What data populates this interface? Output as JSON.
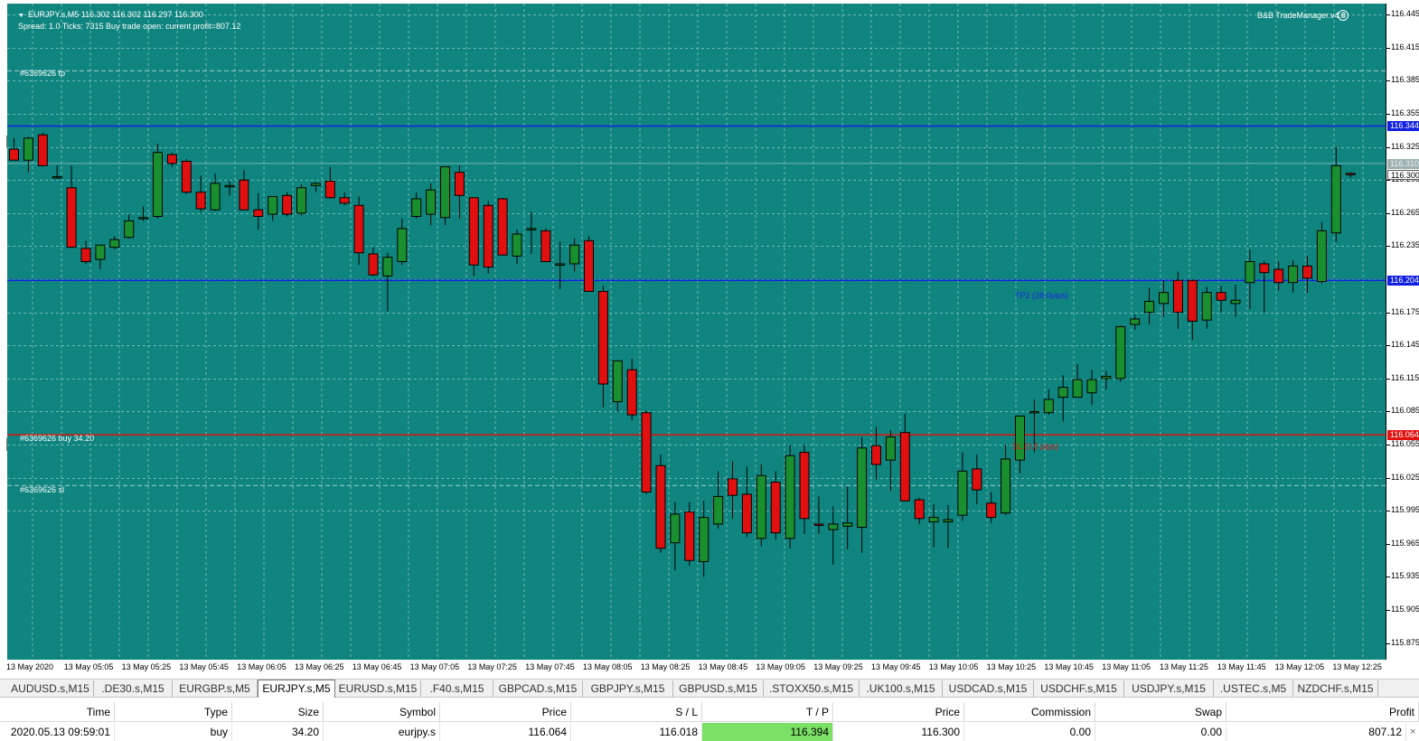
{
  "chart": {
    "symbol_line": "EURJPY.s,M5  116.302 116.302 116.297 116.300",
    "spread_line": "Spread: 1.0  Ticks: 7315  Buy trade open: current profit=807.12",
    "ea_name": "B&B TradeManager.v4.8",
    "colors": {
      "background": "#10857f",
      "grid": "#6fb8b2",
      "bull": "#1a8f2f",
      "bear": "#e01010",
      "tp_line": "#1020e0",
      "entry_line": "#e01010"
    },
    "order_labels": {
      "tp": "#6369626 tp",
      "buy": "#6369626 buy 34.20",
      "sl": "#6369626 sl"
    },
    "line_labels": {
      "tp2": "TP2 (28.0pips)",
      "sl": "SL (0.0 pips)"
    },
    "price_axis": [
      "116.445",
      "116.415",
      "116.385",
      "116.355",
      "116.325",
      "116.295",
      "116.265",
      "116.235",
      "116.175",
      "116.145",
      "116.115",
      "116.085",
      "116.055",
      "116.025",
      "115.995",
      "115.965",
      "115.935",
      "115.905",
      "115.875"
    ],
    "price_badges": {
      "upper_blue": "116.344",
      "grey": "116.310",
      "current": "116.300",
      "lower_blue": "116.204",
      "entry": "116.064"
    },
    "time_axis": [
      "13 May 2020",
      "13 May 05:05",
      "13 May 05:25",
      "13 May 05:45",
      "13 May 06:05",
      "13 May 06:25",
      "13 May 06:45",
      "13 May 07:05",
      "13 May 07:25",
      "13 May 07:45",
      "13 May 08:05",
      "13 May 08:25",
      "13 May 08:45",
      "13 May 09:05",
      "13 May 09:25",
      "13 May 09:45",
      "13 May 10:05",
      "13 May 10:25",
      "13 May 10:45",
      "13 May 11:05",
      "13 May 11:25",
      "13 May 11:45",
      "13 May 12:05",
      "13 May 12:25"
    ]
  },
  "tabs": [
    "AUDUSD.s,M15",
    ".DE30.s,M15",
    "EURGBP.s,M5",
    "EURJPY.s,M5",
    "EURUSD.s,M15",
    ".F40.s,M15",
    "GBPCAD.s,M15",
    "GBPJPY.s,M15",
    "GBPUSD.s,M15",
    ".STOXX50.s,M15",
    ".UK100.s,M15",
    "USDCAD.s,M15",
    "USDCHF.s,M15",
    "USDJPY.s,M15",
    ".USTEC.s,M5",
    "NZDCHF.s,M15"
  ],
  "active_tab": "EURJPY.s,M5",
  "trade_table": {
    "headers": [
      "Time",
      "Type",
      "Size",
      "Symbol",
      "Price",
      "S / L",
      "T / P",
      "Price",
      "Commission",
      "Swap",
      "Profit"
    ],
    "row": [
      "2020.05.13 09:59:01",
      "buy",
      "34.20",
      "eurjpy.s",
      "116.064",
      "116.018",
      "116.394",
      "116.300",
      "0.00",
      "0.00",
      "807.12"
    ],
    "close_icon": "×"
  },
  "chart_data": {
    "type": "candlestick",
    "symbol": "EURJPY.s",
    "timeframe": "M5",
    "ylim": [
      115.86,
      116.455
    ],
    "levels": {
      "tp": 116.394,
      "tp2": 116.204,
      "entry": 116.064,
      "sl": 116.018,
      "upper_blue": 116.344
    },
    "candles": [
      [
        116.323,
        116.333,
        116.313,
        116.313
      ],
      [
        116.313,
        116.334,
        116.302,
        116.333
      ],
      [
        116.336,
        116.338,
        116.308,
        116.308
      ],
      [
        116.298,
        116.308,
        116.296,
        116.298
      ],
      [
        116.288,
        116.308,
        116.234,
        116.234
      ],
      [
        116.233,
        116.24,
        116.219,
        116.221
      ],
      [
        116.223,
        116.236,
        116.214,
        116.236
      ],
      [
        116.234,
        116.244,
        116.232,
        116.241
      ],
      [
        116.243,
        116.264,
        116.242,
        116.258
      ],
      [
        116.26,
        116.271,
        116.258,
        116.261
      ],
      [
        116.262,
        116.328,
        116.26,
        116.32
      ],
      [
        116.318,
        116.32,
        116.307,
        116.31
      ],
      [
        116.312,
        116.314,
        116.282,
        116.284
      ],
      [
        116.284,
        116.299,
        116.266,
        116.269
      ],
      [
        116.268,
        116.301,
        116.267,
        116.292
      ],
      [
        116.29,
        116.294,
        116.281,
        116.29
      ],
      [
        116.295,
        116.304,
        116.268,
        116.268
      ],
      [
        116.268,
        116.283,
        116.25,
        116.262
      ],
      [
        116.264,
        116.28,
        116.258,
        116.28
      ],
      [
        116.281,
        116.284,
        116.262,
        116.264
      ],
      [
        116.265,
        116.291,
        116.263,
        116.288
      ],
      [
        116.29,
        116.293,
        116.284,
        116.292
      ],
      [
        116.294,
        116.307,
        116.278,
        116.279
      ],
      [
        116.279,
        116.284,
        116.272,
        116.274
      ],
      [
        116.272,
        116.28,
        116.218,
        116.229
      ],
      [
        116.228,
        116.234,
        116.208,
        116.209
      ],
      [
        116.208,
        116.229,
        116.176,
        116.225
      ],
      [
        116.221,
        116.26,
        116.218,
        116.251
      ],
      [
        116.262,
        116.284,
        116.26,
        116.278
      ],
      [
        116.264,
        116.292,
        116.254,
        116.286
      ],
      [
        116.261,
        116.306,
        116.254,
        116.307
      ],
      [
        116.302,
        116.308,
        116.26,
        116.281
      ],
      [
        116.279,
        116.279,
        116.208,
        116.218
      ],
      [
        116.272,
        116.276,
        116.21,
        116.216
      ],
      [
        116.278,
        116.279,
        116.228,
        116.227
      ],
      [
        116.226,
        116.25,
        116.219,
        116.246
      ],
      [
        116.251,
        116.266,
        116.228,
        116.251
      ],
      [
        116.249,
        116.251,
        116.223,
        116.221
      ],
      [
        116.219,
        116.239,
        116.196,
        116.219
      ],
      [
        116.219,
        116.242,
        116.212,
        116.236
      ],
      [
        116.24,
        116.244,
        116.207,
        116.194
      ],
      [
        116.194,
        116.199,
        116.089,
        116.11
      ],
      [
        116.094,
        116.13,
        116.085,
        116.131
      ],
      [
        116.123,
        116.133,
        116.077,
        116.082
      ],
      [
        116.084,
        116.086,
        116.01,
        116.012
      ],
      [
        116.036,
        116.046,
        115.957,
        115.961
      ],
      [
        115.966,
        116.003,
        115.941,
        115.992
      ],
      [
        115.994,
        116.003,
        115.945,
        115.95
      ],
      [
        115.949,
        116.004,
        115.935,
        115.989
      ],
      [
        115.983,
        116.031,
        115.979,
        116.008
      ],
      [
        116.024,
        116.04,
        115.988,
        116.009
      ],
      [
        116.01,
        116.035,
        115.971,
        115.975
      ],
      [
        115.97,
        116.037,
        115.963,
        116.027
      ],
      [
        116.021,
        116.031,
        115.969,
        115.975
      ],
      [
        115.97,
        116.055,
        115.961,
        116.045
      ],
      [
        116.048,
        116.055,
        115.974,
        115.988
      ],
      [
        115.983,
        116.008,
        115.974,
        115.982
      ],
      [
        115.978,
        115.999,
        115.946,
        115.983
      ],
      [
        115.981,
        116.017,
        115.96,
        115.984
      ],
      [
        115.98,
        116.062,
        115.957,
        116.052
      ],
      [
        116.054,
        116.071,
        116.023,
        116.037
      ],
      [
        116.041,
        116.068,
        116.013,
        116.062
      ],
      [
        116.066,
        116.083,
        116.008,
        116.004
      ],
      [
        116.005,
        116.007,
        115.983,
        115.988
      ],
      [
        115.985,
        116.001,
        115.962,
        115.989
      ],
      [
        115.985,
        116.0,
        115.961,
        115.987
      ],
      [
        115.991,
        116.048,
        115.986,
        116.031
      ],
      [
        116.033,
        116.046,
        116.001,
        116.014
      ],
      [
        116.002,
        116.012,
        115.984,
        115.989
      ],
      [
        115.993,
        116.055,
        115.991,
        116.042
      ],
      [
        116.041,
        116.069,
        116.029,
        116.081
      ],
      [
        116.084,
        116.096,
        116.048,
        116.085
      ],
      [
        116.084,
        116.105,
        116.082,
        116.096
      ],
      [
        116.098,
        116.118,
        116.076,
        116.107
      ],
      [
        116.098,
        116.128,
        116.098,
        116.114
      ],
      [
        116.102,
        116.123,
        116.091,
        116.114
      ],
      [
        116.115,
        116.122,
        116.105,
        116.117
      ],
      [
        116.115,
        116.163,
        116.112,
        116.162
      ],
      [
        116.164,
        116.173,
        116.159,
        116.169
      ],
      [
        116.175,
        116.197,
        116.164,
        116.185
      ],
      [
        116.183,
        116.204,
        116.171,
        116.193
      ],
      [
        116.204,
        116.212,
        116.16,
        116.175
      ],
      [
        116.204,
        116.204,
        116.15,
        116.167
      ],
      [
        116.168,
        116.198,
        116.16,
        116.193
      ],
      [
        116.193,
        116.199,
        116.175,
        116.186
      ],
      [
        116.183,
        116.2,
        116.171,
        116.186
      ],
      [
        116.202,
        116.232,
        116.178,
        116.221
      ],
      [
        116.219,
        116.222,
        116.175,
        116.211
      ],
      [
        116.214,
        116.221,
        116.195,
        116.202
      ],
      [
        116.202,
        116.222,
        116.193,
        116.217
      ],
      [
        116.217,
        116.226,
        116.193,
        116.206
      ],
      [
        116.203,
        116.257,
        116.201,
        116.249
      ],
      [
        116.247,
        116.325,
        116.239,
        116.308
      ],
      [
        116.301,
        116.302,
        116.297,
        116.3
      ]
    ]
  }
}
